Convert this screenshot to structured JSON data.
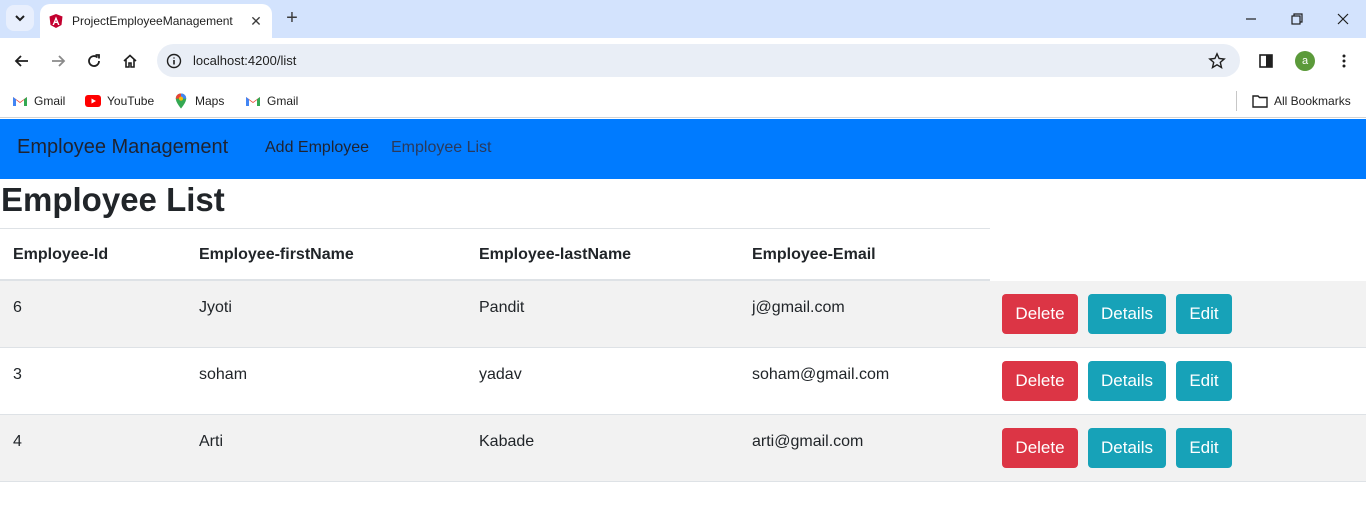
{
  "browser": {
    "tab_title": "ProjectEmployeeManagement",
    "url": "localhost:4200/list",
    "profile_initial": "a",
    "bookmarks": [
      {
        "label": "Gmail",
        "icon": "gmail-icon"
      },
      {
        "label": "YouTube",
        "icon": "youtube-icon"
      },
      {
        "label": "Maps",
        "icon": "maps-icon"
      },
      {
        "label": "Gmail",
        "icon": "gmail-icon"
      }
    ],
    "all_bookmarks": "All Bookmarks"
  },
  "navbar": {
    "brand": "Employee Management",
    "links": [
      {
        "label": "Add Employee",
        "color": "#1f2330"
      },
      {
        "label": "Employee List",
        "color": "#2a3a5c"
      }
    ],
    "background": "#007bff"
  },
  "page": {
    "title": "Employee List"
  },
  "table": {
    "headers": [
      "Employee-Id",
      "Employee-firstName",
      "Employee-lastName",
      "Employee-Email"
    ],
    "rows": [
      {
        "id": "6",
        "first": "Jyoti",
        "last": "Pandit",
        "email": "j@gmail.com"
      },
      {
        "id": "3",
        "first": "soham",
        "last": "yadav",
        "email": "soham@gmail.com"
      },
      {
        "id": "4",
        "first": "Arti",
        "last": "Kabade",
        "email": "arti@gmail.com"
      }
    ],
    "actions": {
      "delete": "Delete",
      "details": "Details",
      "edit": "Edit"
    }
  },
  "colors": {
    "danger": "#dc3545",
    "info": "#17a2b8"
  }
}
